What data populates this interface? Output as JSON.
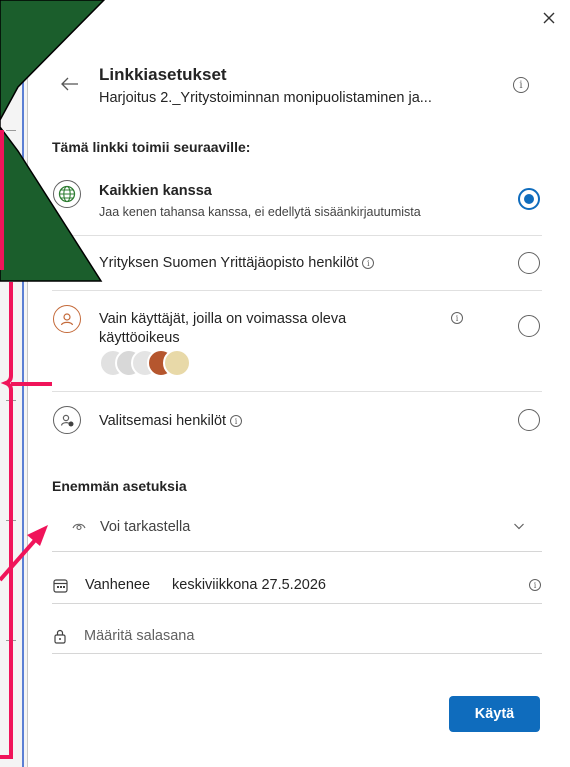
{
  "header": {
    "title": "Linkkiasetukset",
    "subtitle": "Harjoitus 2._Yritystoiminnan monipuolistaminen ja..."
  },
  "audience": {
    "heading": "Tämä linkki toimii seuraaville:",
    "options": [
      {
        "title": "Kaikkien kanssa",
        "description": "Jaa kenen tahansa kanssa, ei edellytä sisäänkirjautumista",
        "selected": true,
        "icon": "globe-icon"
      },
      {
        "title": "Yrityksen Suomen Yrittäjäopisto henkilöt",
        "selected": false,
        "icon": "organization-icon"
      },
      {
        "title_line1": "Vain käyttäjät, joilla on voimassa oleva",
        "title_line2": "käyttöoikeus",
        "selected": false,
        "icon": "person-icon"
      },
      {
        "title": "Valitsemasi henkilöt",
        "selected": false,
        "icon": "people-settings-icon"
      }
    ]
  },
  "more_settings": {
    "heading": "Enemmän asetuksia",
    "permission": {
      "value": "Voi tarkastella",
      "icon": "eye-icon"
    },
    "expiry": {
      "label": "Vanhenee",
      "value": "keskiviikkona 27.5.2026",
      "icon": "calendar-icon"
    },
    "password": {
      "placeholder": "Määritä salasana",
      "icon": "lock-icon"
    }
  },
  "footer": {
    "apply_label": "Käytä"
  },
  "info_glyph": "i",
  "colors": {
    "accent": "#0f6cbd",
    "annotation_green": "#1b5e2c",
    "annotation_pink": "#f0145a"
  }
}
